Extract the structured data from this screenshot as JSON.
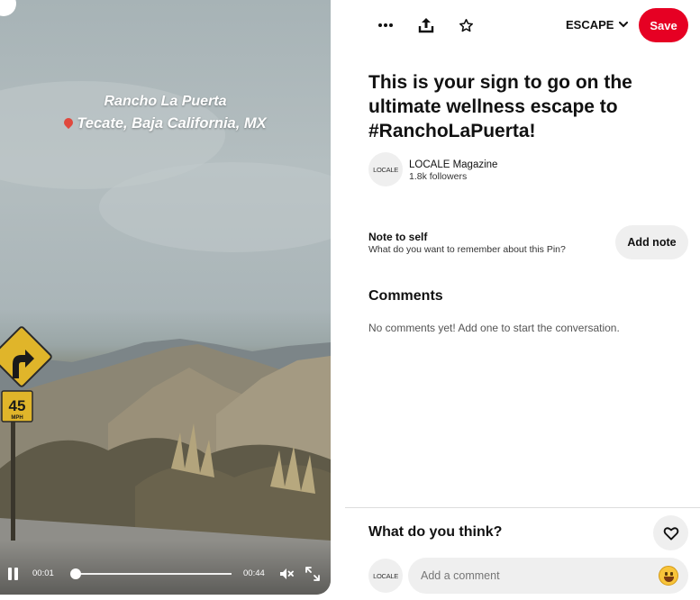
{
  "video": {
    "overlay_line1": "Rancho La Puerta",
    "overlay_line2": "Tecate, Baja California, MX",
    "current_time": "00:01",
    "duration": "00:44",
    "progress": 0.02,
    "sign_speed": "45",
    "sign_unit": "MPH",
    "state": "playing",
    "muted": true
  },
  "toolbar": {
    "more_icon": "more-dots-icon",
    "share_icon": "share-upload-icon",
    "star_icon": "star-icon",
    "board_name": "ESCAPE",
    "save_label": "Save",
    "accent_color": "#e60023"
  },
  "pin": {
    "title": "This is your sign to go on the ultimate wellness escape to #RanchoLaPuerta!"
  },
  "creator": {
    "avatar_text": "LOCALE",
    "name": "LOCALE Magazine",
    "followers": "1.8k followers"
  },
  "note": {
    "title": "Note to self",
    "subtitle": "What do you want to remember about this Pin?",
    "button_label": "Add note"
  },
  "comments": {
    "title": "Comments",
    "empty_text": "No comments yet! Add one to start the conversation."
  },
  "footer": {
    "prompt": "What do you think?",
    "avatar_text": "LOCALE",
    "comment_placeholder": "Add a comment"
  }
}
